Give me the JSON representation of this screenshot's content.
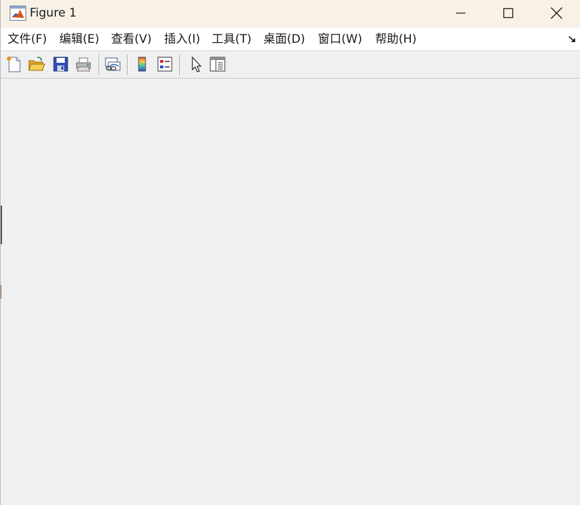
{
  "window": {
    "title": "Figure 1",
    "controls": {
      "minimize": "minimize",
      "maximize": "maximize",
      "close": "close"
    }
  },
  "menu": {
    "items": [
      {
        "label": "文件(F)"
      },
      {
        "label": "编辑(E)"
      },
      {
        "label": "查看(V)"
      },
      {
        "label": "插入(I)"
      },
      {
        "label": "工具(T)"
      },
      {
        "label": "桌面(D)"
      },
      {
        "label": "窗口(W)"
      },
      {
        "label": "帮助(H)"
      }
    ]
  },
  "toolbar": {
    "buttons": [
      {
        "icon": "new-figure-icon"
      },
      {
        "icon": "open-file-icon"
      },
      {
        "icon": "save-icon"
      },
      {
        "icon": "print-icon"
      },
      {
        "icon": "link-plot-icon"
      },
      {
        "icon": "insert-colorbar-icon"
      },
      {
        "icon": "insert-legend-icon"
      },
      {
        "icon": "edit-plot-icon"
      },
      {
        "icon": "property-inspector-icon"
      }
    ]
  },
  "colors": {
    "titlebar": "#f8f1e6",
    "menubar": "#ffffff",
    "background": "#f0f0f0"
  }
}
